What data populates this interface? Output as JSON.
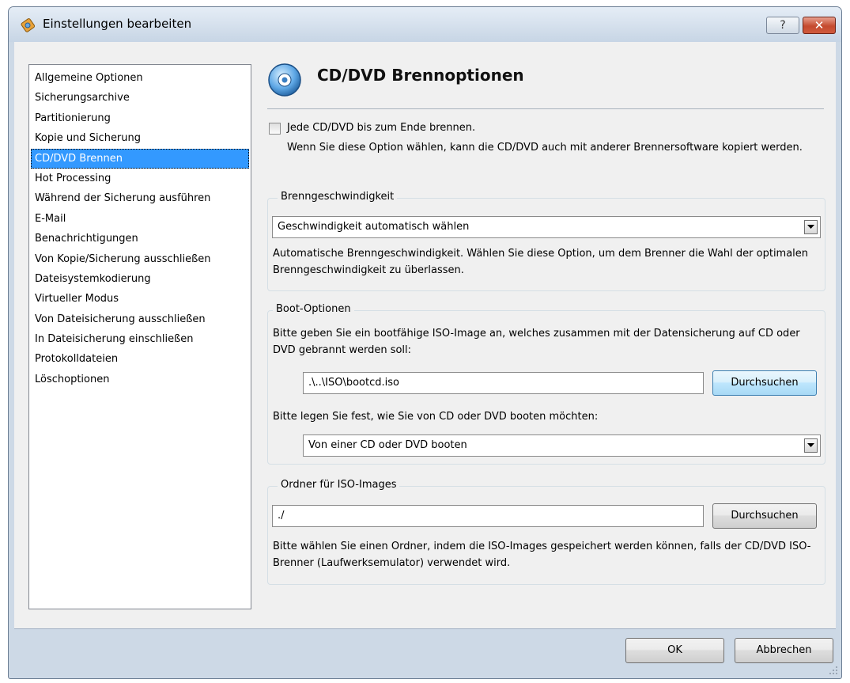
{
  "window": {
    "title": "Einstellungen bearbeiten",
    "help_label": "?",
    "close_label": "✕"
  },
  "sidebar": {
    "items": [
      {
        "label": "Allgemeine Optionen"
      },
      {
        "label": "Sicherungsarchive"
      },
      {
        "label": "Partitionierung"
      },
      {
        "label": "Kopie und Sicherung"
      },
      {
        "label": "CD/DVD Brennen",
        "selected": true
      },
      {
        "label": "Hot Processing"
      },
      {
        "label": "Während der Sicherung ausführen"
      },
      {
        "label": "E-Mail"
      },
      {
        "label": "Benachrichtigungen"
      },
      {
        "label": "Von Kopie/Sicherung ausschließen"
      },
      {
        "label": "Dateisystemkodierung"
      },
      {
        "label": "Virtueller Modus"
      },
      {
        "label": "Von Dateisicherung ausschließen"
      },
      {
        "label": "In Dateisicherung einschließen"
      },
      {
        "label": "Protokolldateien"
      },
      {
        "label": "Löschoptionen"
      }
    ]
  },
  "main": {
    "title": "CD/DVD Brennoptionen",
    "burn_to_end": {
      "label": "Jede CD/DVD bis zum Ende brennen.",
      "checked": false,
      "description": "Wenn Sie diese Option wählen, kann die CD/DVD auch mit anderer Brennersoftware kopiert werden."
    },
    "speed_group": {
      "title": "Brenngeschwindigkeit",
      "selected": "Geschwindigkeit automatisch wählen",
      "description": "Automatische Brenngeschwindigkeit. Wählen Sie diese Option, um dem Brenner die Wahl der optimalen Brenngeschwindigkeit zu überlassen."
    },
    "boot_group": {
      "title": "Boot-Optionen",
      "description": "Bitte geben Sie ein bootfähige ISO-Image an, welches zusammen mit der Datensicherung auf CD oder DVD gebrannt werden soll:",
      "iso_path": ".\\..\\ISO\\bootcd.iso",
      "browse_label": "Durchsuchen",
      "boot_mode_label": "Bitte legen Sie fest, wie Sie von CD oder DVD booten möchten:",
      "boot_mode_selected": "Von einer CD oder DVD booten"
    },
    "iso_folder_group": {
      "title": "Ordner für ISO-Images",
      "path": "./",
      "browse_label": "Durchsuchen",
      "description": "Bitte wählen Sie einen Ordner, indem die ISO-Images gespeichert werden können, falls der CD/DVD ISO-Brenner (Laufwerksemulator) verwendet wird."
    }
  },
  "footer": {
    "ok_label": "OK",
    "cancel_label": "Abbrechen"
  }
}
